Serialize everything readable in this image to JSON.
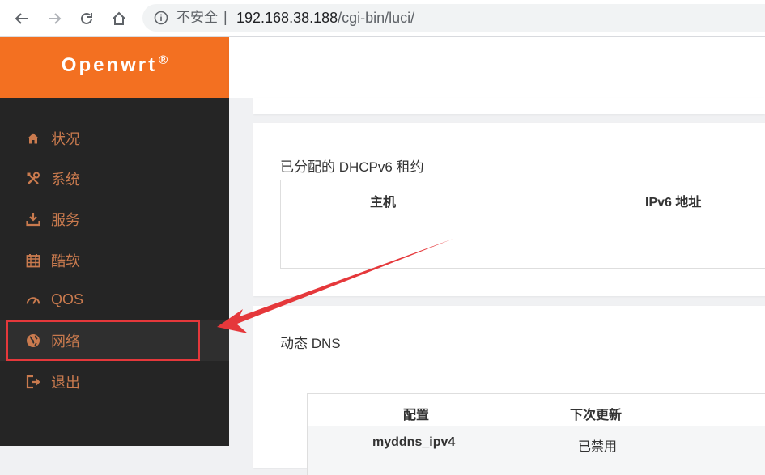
{
  "browser": {
    "security_label": "不安全",
    "separator": "|",
    "url_host": "192.168.38.188",
    "url_path": "/cgi-bin/luci/"
  },
  "logo": {
    "name": "Openwrt",
    "mark": "®"
  },
  "sidebar": {
    "items": [
      {
        "label": "状况",
        "icon": "home-icon"
      },
      {
        "label": "系统",
        "icon": "tools-icon"
      },
      {
        "label": "服务",
        "icon": "download-icon"
      },
      {
        "label": "酷软",
        "icon": "calendar-icon"
      },
      {
        "label": "QOS",
        "icon": "gauge-icon"
      },
      {
        "label": "网络",
        "icon": "globe-icon",
        "active": true
      },
      {
        "label": "退出",
        "icon": "logout-icon"
      }
    ]
  },
  "dhcpv6": {
    "title": "已分配的 DHCPv6 租约",
    "columns": [
      "主机",
      "IPv6 地址"
    ]
  },
  "ddns": {
    "title": "动态 DNS",
    "columns": [
      "配置",
      "下次更新"
    ],
    "rows": [
      {
        "config": "myddns_ipv4",
        "next_update": "已禁用"
      }
    ]
  },
  "colors": {
    "accent": "#f37021",
    "sidebar_bg": "#252525",
    "sidebar_text": "#c97a4e",
    "annotation": "#e5383b"
  }
}
